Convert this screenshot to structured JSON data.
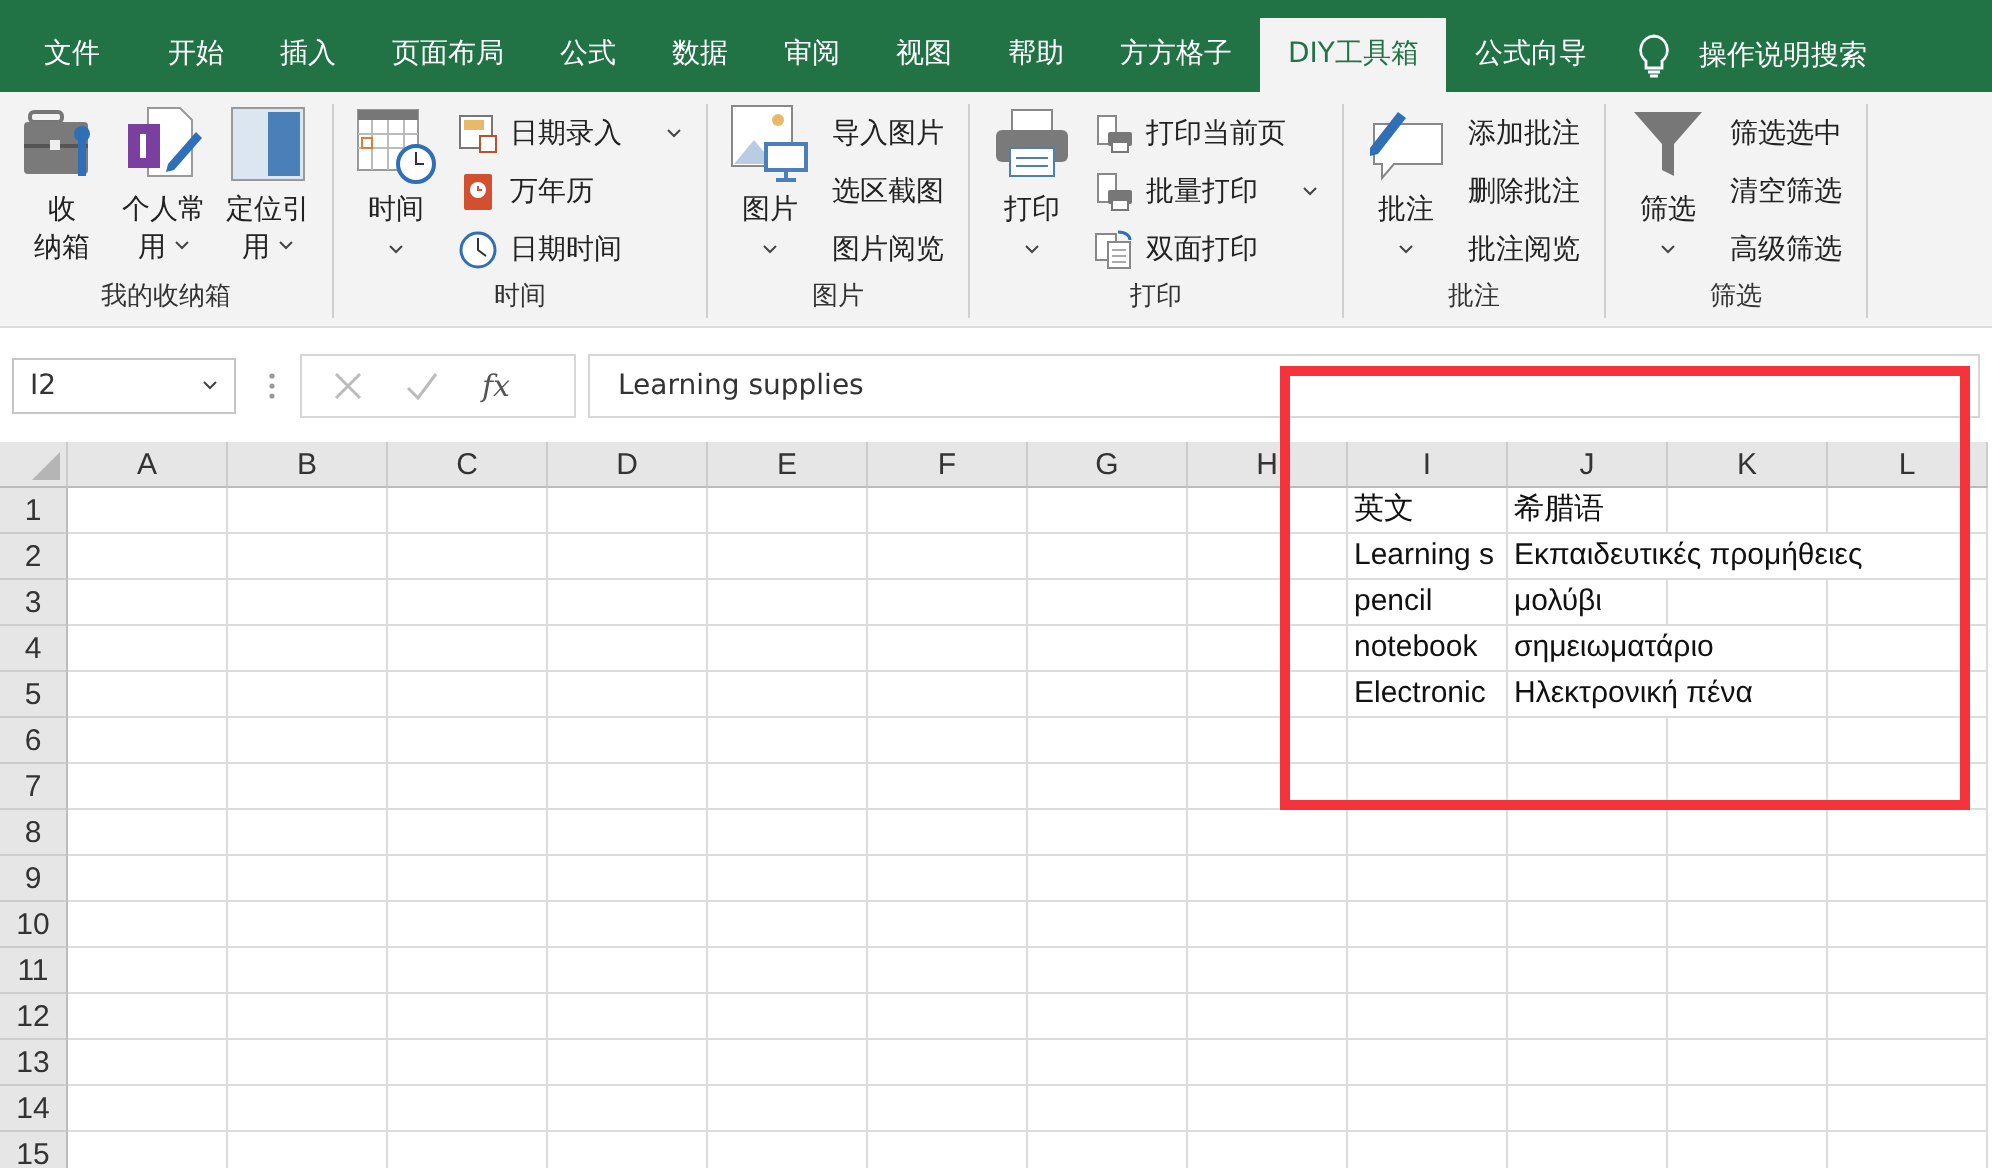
{
  "tabs": [
    {
      "label": "文件",
      "selected": false
    },
    {
      "label": "开始",
      "selected": false
    },
    {
      "label": "插入",
      "selected": false
    },
    {
      "label": "页面布局",
      "selected": false
    },
    {
      "label": "公式",
      "selected": false
    },
    {
      "label": "数据",
      "selected": false
    },
    {
      "label": "审阅",
      "selected": false
    },
    {
      "label": "视图",
      "selected": false
    },
    {
      "label": "帮助",
      "selected": false
    },
    {
      "label": "方方格子",
      "selected": false
    },
    {
      "label": "DIY工具箱",
      "selected": true
    },
    {
      "label": "公式向导",
      "selected": false
    }
  ],
  "search": {
    "label": "操作说明搜索"
  },
  "ribbon": {
    "groups": [
      {
        "title": "我的收纳箱",
        "buttons": [
          {
            "lines": [
              "收",
              "纳箱"
            ],
            "dropdown": false
          },
          {
            "lines": [
              "个人常",
              "用"
            ],
            "dropdown": true
          },
          {
            "lines": [
              "定位引",
              "用"
            ],
            "dropdown": true
          }
        ]
      },
      {
        "title": "时间",
        "buttons": [
          {
            "lines": [
              "时间"
            ],
            "dropdown": true
          }
        ],
        "commands": [
          {
            "label": "日期录入",
            "dropdown": true
          },
          {
            "label": "万年历",
            "dropdown": false
          },
          {
            "label": "日期时间",
            "dropdown": false
          }
        ]
      },
      {
        "title": "图片",
        "buttons": [
          {
            "lines": [
              "图片"
            ],
            "dropdown": true
          }
        ],
        "commands": [
          {
            "label": "导入图片",
            "dropdown": false
          },
          {
            "label": "选区截图",
            "dropdown": false
          },
          {
            "label": "图片阅览",
            "dropdown": false
          }
        ]
      },
      {
        "title": "打印",
        "buttons": [
          {
            "lines": [
              "打印"
            ],
            "dropdown": true
          }
        ],
        "commands": [
          {
            "label": "打印当前页",
            "dropdown": false
          },
          {
            "label": "批量打印",
            "dropdown": true
          },
          {
            "label": "双面打印",
            "dropdown": false
          }
        ]
      },
      {
        "title": "批注",
        "buttons": [
          {
            "lines": [
              "批注"
            ],
            "dropdown": true
          }
        ],
        "commands": [
          {
            "label": "添加批注",
            "dropdown": false
          },
          {
            "label": "删除批注",
            "dropdown": false
          },
          {
            "label": "批注阅览",
            "dropdown": false
          }
        ]
      },
      {
        "title": "筛选",
        "buttons": [
          {
            "lines": [
              "筛选"
            ],
            "dropdown": true
          }
        ],
        "commands": [
          {
            "label": "筛选选中",
            "dropdown": false
          },
          {
            "label": "清空筛选",
            "dropdown": false
          },
          {
            "label": "高级筛选",
            "dropdown": false
          }
        ]
      }
    ]
  },
  "formula_bar": {
    "name_box": "I2",
    "function_label": "fx",
    "value": "Learning supplies"
  },
  "sheet": {
    "columns": [
      "A",
      "B",
      "C",
      "D",
      "E",
      "F",
      "G",
      "H",
      "I",
      "J",
      "K",
      "L"
    ],
    "rows": [
      {
        "number": "1",
        "cells": {
          "I": "英文",
          "J": "希腊语"
        }
      },
      {
        "number": "2",
        "cells": {
          "I": "Learning s",
          "J": "Εκπαιδευτικές προμήθειες"
        }
      },
      {
        "number": "3",
        "cells": {
          "I": "pencil",
          "J": "μολύβι"
        }
      },
      {
        "number": "4",
        "cells": {
          "I": "notebook",
          "J": "σημειωματάριο"
        }
      },
      {
        "number": "5",
        "cells": {
          "I": "Electronic",
          "J": "Ηλεκτρονική πένα"
        }
      },
      {
        "number": "6",
        "cells": {}
      },
      {
        "number": "7",
        "cells": {}
      },
      {
        "number": "8",
        "cells": {}
      },
      {
        "number": "9",
        "cells": {}
      },
      {
        "number": "10",
        "cells": {}
      },
      {
        "number": "11",
        "cells": {}
      },
      {
        "number": "12",
        "cells": {}
      },
      {
        "number": "13",
        "cells": {}
      },
      {
        "number": "14",
        "cells": {}
      },
      {
        "number": "15",
        "cells": {}
      }
    ]
  }
}
